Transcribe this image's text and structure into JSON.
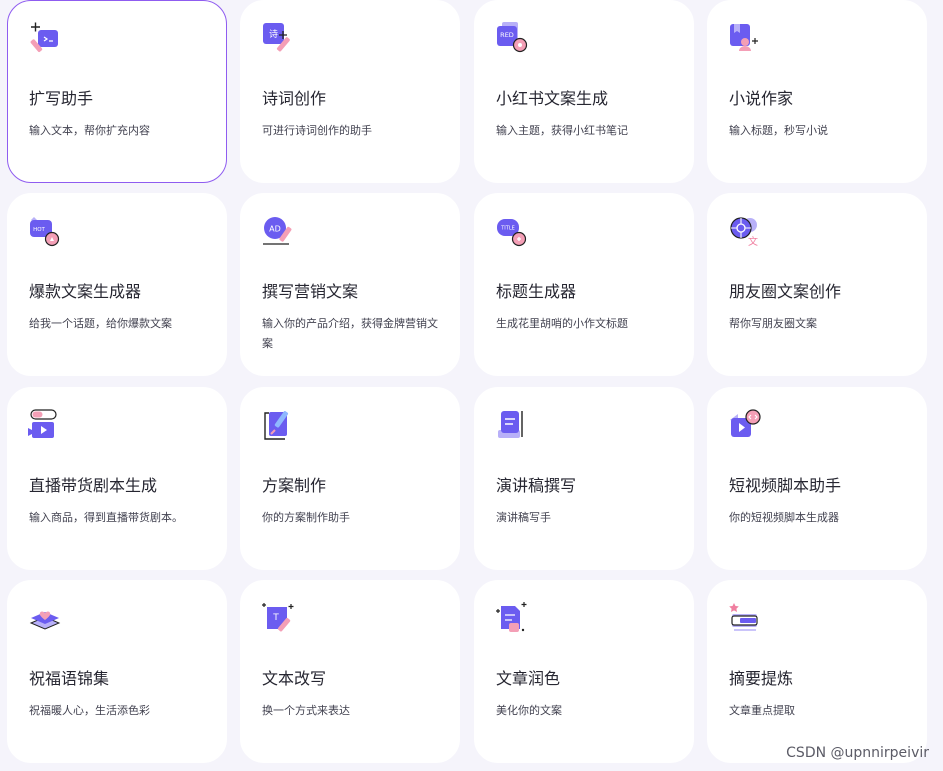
{
  "cards": [
    {
      "title": "扩写助手",
      "desc": "输入文本，帮你扩充内容",
      "icon": "expand-writing-icon"
    },
    {
      "title": "诗词创作",
      "desc": "可进行诗词创作的助手",
      "icon": "poem-icon",
      "badge": "诗"
    },
    {
      "title": "小红书文案生成",
      "desc": "输入主题，获得小红书笔记",
      "icon": "red-note-icon",
      "badge": "RED"
    },
    {
      "title": "小说作家",
      "desc": "输入标题，秒写小说",
      "icon": "novel-writer-icon"
    },
    {
      "title": "爆款文案生成器",
      "desc": "给我一个话题，给你爆款文案",
      "icon": "hot-copy-icon",
      "badge": "HOT"
    },
    {
      "title": "撰写营销文案",
      "desc": "输入你的产品介绍，获得金牌营销文案",
      "icon": "ad-copy-icon",
      "badge": "AD"
    },
    {
      "title": "标题生成器",
      "desc": "生成花里胡哨的小作文标题",
      "icon": "title-generator-icon",
      "badge": "TITLE"
    },
    {
      "title": "朋友圈文案创作",
      "desc": "帮你写朋友圈文案",
      "icon": "moments-icon",
      "badge": "文"
    },
    {
      "title": "直播带货剧本生成",
      "desc": "输入商品，得到直播带货剧本。",
      "icon": "live-stream-icon"
    },
    {
      "title": "方案制作",
      "desc": "你的方案制作助手",
      "icon": "plan-icon"
    },
    {
      "title": "演讲稿撰写",
      "desc": "演讲稿写手",
      "icon": "speech-icon"
    },
    {
      "title": "短视频脚本助手",
      "desc": "你的短视频脚本生成器",
      "icon": "short-video-icon"
    },
    {
      "title": "祝福语锦集",
      "desc": "祝福暖人心，生活添色彩",
      "icon": "blessing-icon"
    },
    {
      "title": "文本改写",
      "desc": "换一个方式来表达",
      "icon": "rewrite-icon",
      "badge": "T"
    },
    {
      "title": "文章润色",
      "desc": "美化你的文案",
      "icon": "polish-icon"
    },
    {
      "title": "摘要提炼",
      "desc": "文章重点提取",
      "icon": "summary-icon"
    }
  ],
  "watermark": "CSDN @upnnirpeivir",
  "colors": {
    "accent": "#6b5cf0",
    "pink": "#f49fb6",
    "active_border": "#8f5cf0",
    "background": "#f5f4fb"
  }
}
